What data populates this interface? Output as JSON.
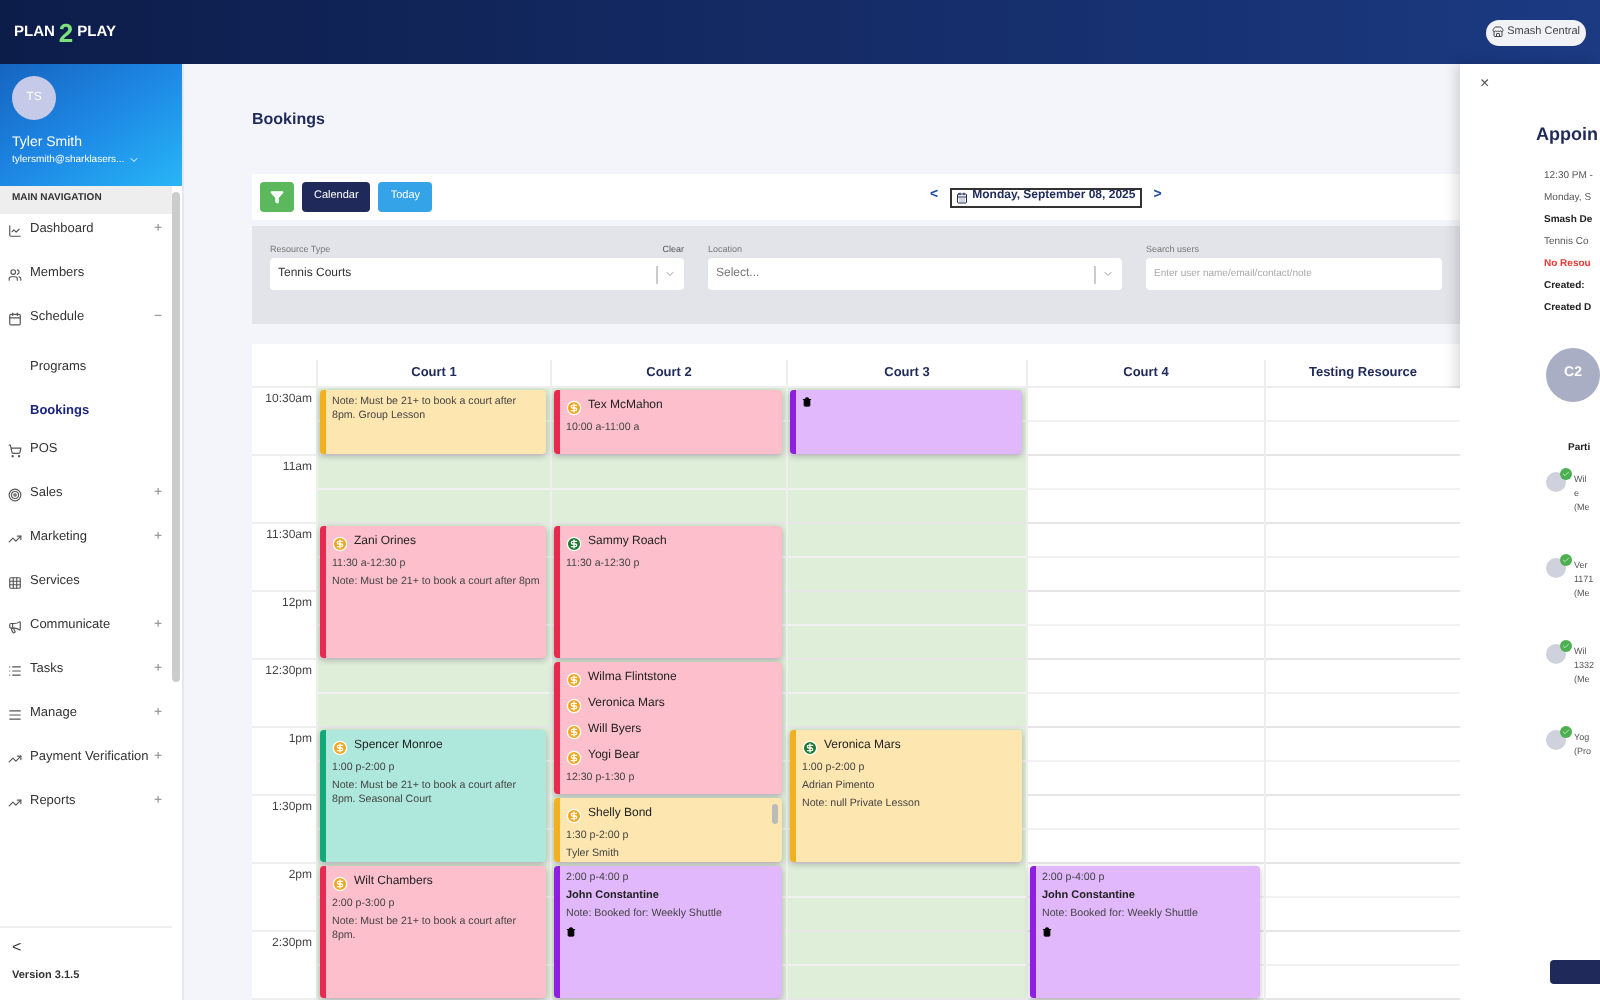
{
  "header": {
    "logo": [
      "PLAN",
      "2",
      "PLAY"
    ],
    "location_button": "Smash Central"
  },
  "sidebar": {
    "profile": {
      "initials": "TS",
      "name": "Tyler Smith",
      "email": "tylersmith@sharklasers..."
    },
    "section_label": "MAIN NAVIGATION",
    "items": [
      {
        "label": "Dashboard",
        "toggle": "+"
      },
      {
        "label": "Members"
      },
      {
        "label": "Schedule",
        "toggle": "−",
        "children": [
          {
            "label": "Programs",
            "selected": false
          },
          {
            "label": "Bookings",
            "selected": true
          }
        ]
      },
      {
        "label": "POS"
      },
      {
        "label": "Sales",
        "toggle": "+"
      },
      {
        "label": "Marketing",
        "toggle": "+"
      },
      {
        "label": "Services"
      },
      {
        "label": "Communicate",
        "toggle": "+"
      },
      {
        "label": "Tasks",
        "toggle": "+"
      },
      {
        "label": "Manage",
        "toggle": "+"
      },
      {
        "label": "Payment Verification",
        "toggle": "+"
      },
      {
        "label": "Reports",
        "toggle": "+"
      }
    ],
    "collapse": "<",
    "version": "Version 3.1.5"
  },
  "page_title": "Bookings",
  "toolbar": {
    "calendar_button": "Calendar",
    "today_button": "Today",
    "prev": "<",
    "date": "Monday, September 08, 2025",
    "next": ">"
  },
  "filters": {
    "resource_type": {
      "label": "Resource Type",
      "clear": "Clear",
      "value": "Tennis Courts"
    },
    "location": {
      "label": "Location",
      "placeholder": "Select..."
    },
    "search": {
      "label": "Search users",
      "placeholder": "Enter user name/email/contact/note"
    }
  },
  "calendar": {
    "time_labels": [
      "10:30am",
      "11am",
      "11:30am",
      "12pm",
      "12:30pm",
      "1pm",
      "1:30pm",
      "2pm",
      "2:30pm"
    ],
    "columns": [
      {
        "name": "Court 1",
        "available": true,
        "events": [
          {
            "kind": "lesson",
            "lines": [
              "Note: Must be 21+ to book a court after 8pm. Group Lesson"
            ]
          },
          {
            "kind": "court",
            "participants": [
              {
                "name": "Zani Orines",
                "paid": false
              }
            ],
            "lines": [
              "11:30 a-12:30 p",
              "Note: Must be 21+ to book a court after 8pm"
            ]
          },
          {
            "kind": "seasonal",
            "participants": [
              {
                "name": "Spencer Monroe",
                "paid": false
              }
            ],
            "lines": [
              "1:00 p-2:00 p",
              "Note: Must be 21+ to book a court after 8pm. Seasonal Court"
            ]
          },
          {
            "kind": "court",
            "participants": [
              {
                "name": "Wilt Chambers",
                "paid": false
              }
            ],
            "lines": [
              "2:00 p-3:00 p",
              "Note: Must be 21+ to book a court after 8pm."
            ]
          }
        ]
      },
      {
        "name": "Court 2",
        "available": true,
        "events": [
          {
            "kind": "court",
            "participants": [
              {
                "name": "Tex McMahon",
                "paid": false
              }
            ],
            "lines": [
              "10:00 a-11:00 a"
            ]
          },
          {
            "kind": "court",
            "participants": [
              {
                "name": "Sammy Roach",
                "paid": true
              }
            ],
            "lines": [
              "11:30 a-12:30 p"
            ]
          },
          {
            "kind": "court",
            "participants": [
              {
                "name": "Wilma Flintstone",
                "paid": false
              },
              {
                "name": "Veronica Mars",
                "paid": false
              },
              {
                "name": "Will Byers",
                "paid": false
              },
              {
                "name": "Yogi Bear",
                "paid": false
              }
            ],
            "lines": [
              "12:30 p-1:30 p"
            ]
          },
          {
            "kind": "lesson",
            "scrollable": true,
            "participants": [
              {
                "name": "Shelly Bond",
                "paid": false
              }
            ],
            "lines": [
              "1:30 p-2:00 p",
              "Tyler Smith"
            ]
          },
          {
            "kind": "shuttle",
            "deletable": true,
            "lines": [
              "2:00 p-4:00 p"
            ],
            "booker": "John Constantine",
            "note": "Note: Booked for: Weekly Shuttle"
          }
        ]
      },
      {
        "name": "Court 3",
        "available": true,
        "events": [
          {
            "kind": "shuttle",
            "deletable": true
          },
          {
            "kind": "lesson",
            "participants": [
              {
                "name": "Veronica Mars",
                "paid": true
              }
            ],
            "lines": [
              "1:00 p-2:00 p",
              "Adrian Pimento",
              "Note: null Private Lesson"
            ]
          }
        ]
      },
      {
        "name": "Court 4",
        "available": false,
        "events": [
          {
            "kind": "shuttle",
            "deletable": true,
            "lines": [
              "2:00 p-4:00 p"
            ],
            "booker": "John Constantine",
            "note": "Note: Booked for: Weekly Shuttle"
          }
        ]
      },
      {
        "name": "Testing Resource",
        "available": false
      }
    ]
  },
  "details_panel": {
    "close": "×",
    "title": "Appoin",
    "lines": [
      {
        "kind": "plain",
        "text": "12:30 PM -"
      },
      {
        "kind": "plain",
        "text": "Monday, S"
      },
      {
        "kind": "bold",
        "text": "Smash De"
      },
      {
        "kind": "plain",
        "text": "Tennis Co"
      },
      {
        "kind": "alert",
        "text": "No Resou"
      },
      {
        "kind": "bold",
        "text": "Created:"
      },
      {
        "kind": "bold",
        "text": "Created D"
      }
    ],
    "avatar": "C2",
    "participants_heading": "Parti",
    "participants": [
      {
        "lines": [
          "Wil",
          "e",
          "(Me"
        ],
        "confirmed": true
      },
      {
        "lines": [
          "Ver",
          "1171",
          "(Me"
        ],
        "confirmed": true
      },
      {
        "lines": [
          "Wil",
          "1332",
          "(Me"
        ],
        "confirmed": true
      },
      {
        "lines": [
          "Yog",
          "(Pro"
        ],
        "confirmed": true
      }
    ]
  }
}
